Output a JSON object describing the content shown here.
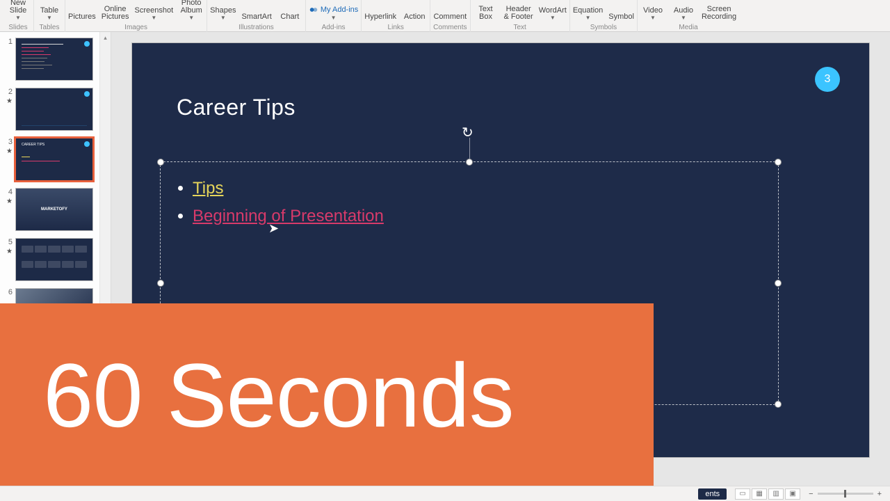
{
  "ribbon": {
    "groups": [
      {
        "label": "Slides",
        "items": [
          {
            "label": "New\nSlide",
            "caret": true
          }
        ]
      },
      {
        "label": "Tables",
        "items": [
          {
            "label": "Table",
            "caret": true
          }
        ]
      },
      {
        "label": "Images",
        "items": [
          {
            "label": "Pictures"
          },
          {
            "label": "Online\nPictures"
          },
          {
            "label": "Screenshot",
            "caret": true
          },
          {
            "label": "Photo\nAlbum",
            "caret": true
          }
        ]
      },
      {
        "label": "Illustrations",
        "items": [
          {
            "label": "Shapes",
            "caret": true
          },
          {
            "label": "SmartArt"
          },
          {
            "label": "Chart"
          }
        ]
      },
      {
        "label": "Add-ins",
        "items": [
          {
            "label": "My Add-ins",
            "caret": true,
            "addins": true
          }
        ]
      },
      {
        "label": "Links",
        "items": [
          {
            "label": "Hyperlink"
          },
          {
            "label": "Action"
          }
        ]
      },
      {
        "label": "Comments",
        "items": [
          {
            "label": "Comment"
          }
        ]
      },
      {
        "label": "Text",
        "items": [
          {
            "label": "Text\nBox"
          },
          {
            "label": "Header\n& Footer"
          },
          {
            "label": "WordArt",
            "caret": true
          }
        ]
      },
      {
        "label": "Symbols",
        "items": [
          {
            "label": "Equation",
            "caret": true
          },
          {
            "label": "Symbol"
          }
        ]
      },
      {
        "label": "Media",
        "items": [
          {
            "label": "Video",
            "caret": true
          },
          {
            "label": "Audio",
            "caret": true
          },
          {
            "label": "Screen\nRecording"
          }
        ]
      }
    ]
  },
  "thumbs": [
    {
      "num": "1",
      "star": false,
      "kind": "thumb1"
    },
    {
      "num": "2",
      "star": true,
      "kind": "thumb2"
    },
    {
      "num": "3",
      "star": true,
      "kind": "thumb3",
      "selected": true
    },
    {
      "num": "4",
      "star": true,
      "kind": "thumb4",
      "center": "MARKETOFY"
    },
    {
      "num": "5",
      "star": true,
      "kind": "thumb5"
    },
    {
      "num": "6",
      "star": false,
      "kind": "thumb6"
    }
  ],
  "slide": {
    "title": "Career Tips",
    "page_number": "3",
    "bullets": {
      "link1": "Tips",
      "link2": "Beginning of Presentation"
    }
  },
  "overlay": {
    "text": "60 Seconds"
  },
  "status": {
    "notes_label": "ents",
    "zoom_minus": "−",
    "zoom_plus": "+"
  }
}
